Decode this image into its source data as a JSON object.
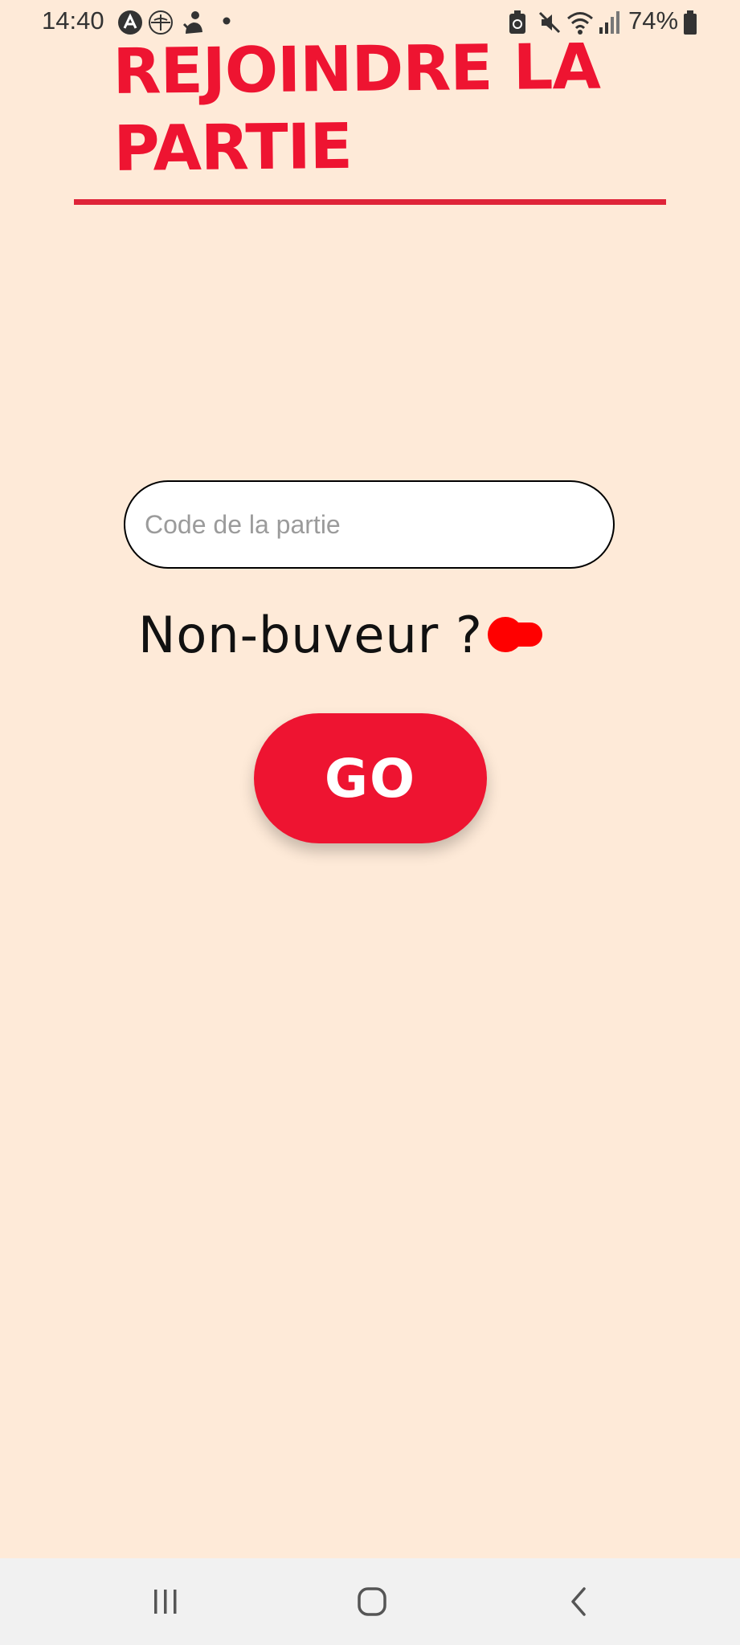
{
  "status_bar": {
    "time": "14:40",
    "battery_percent": "74%",
    "icons": [
      "app-a-icon",
      "compass-app-icon",
      "game-app-icon",
      "notification-dot-icon",
      "battery-saver-icon",
      "mute-icon",
      "wifi-icon",
      "signal-icon",
      "battery-icon"
    ]
  },
  "header": {
    "title": "Rejoindre la partie"
  },
  "form": {
    "code_placeholder": "Code de la partie",
    "code_value": "",
    "non_drinker_label": "Non-buveur ?",
    "non_drinker_enabled": false,
    "go_label": "GO"
  },
  "nav_bar": {
    "items": [
      "recent-apps-icon",
      "home-icon",
      "back-icon"
    ]
  },
  "colors": {
    "background": "#FEEAD8",
    "accent": "#EE1431",
    "toggle": "#FF0000",
    "divider": "#DF2439"
  }
}
